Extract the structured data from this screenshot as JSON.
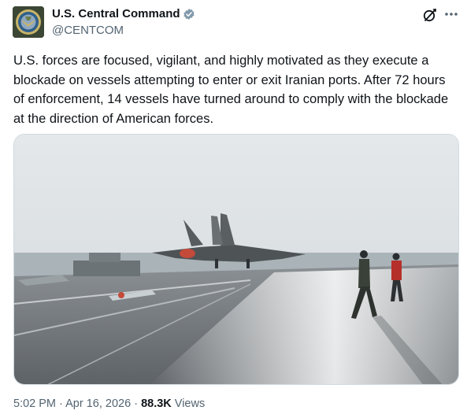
{
  "account": {
    "display_name": "U.S. Central Command",
    "handle": "@CENTCOM"
  },
  "tweet": {
    "text": "U.S. forces are focused, vigilant, and highly motivated as they execute a blockade on vessels attempting to enter or exit Iranian ports. After 72 hours of enforcement, 14 vessels have turned around to comply with the blockade at the direction of American forces."
  },
  "meta": {
    "time": "5:02 PM",
    "separator": "·",
    "date": "Apr 16, 2026",
    "views_count": "88.3K",
    "views_label": "Views"
  },
  "icons": {
    "verified": "verified-badge-icon",
    "grok": "grok-icon",
    "more": "more-options-icon"
  },
  "colors": {
    "verified": "#829aab",
    "secondary_text": "#536471",
    "primary_text": "#0f1419"
  }
}
